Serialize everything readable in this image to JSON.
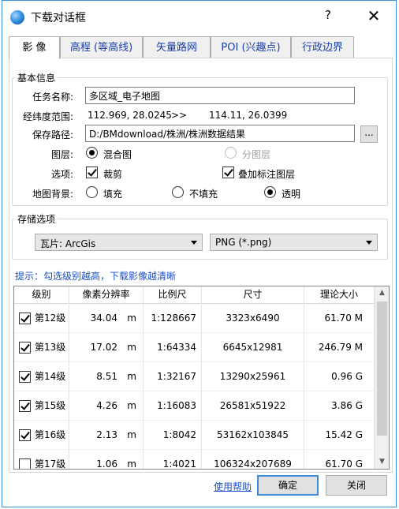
{
  "window": {
    "title": "下载对话框",
    "help_label": "?",
    "close_label": "✕"
  },
  "tabs": [
    {
      "label": "影 像",
      "active": true
    },
    {
      "label": "高程 (等高线)",
      "active": false
    },
    {
      "label": "矢量路网",
      "active": false
    },
    {
      "label": "POI (兴趣点)",
      "active": false
    },
    {
      "label": "行政边界",
      "active": false
    }
  ],
  "basic_info": {
    "group_title": "基本信息",
    "task_name_label": "任务名称:",
    "task_name_value": "多区域_电子地图",
    "lnglat_label": "经纬度范围:",
    "lnglat_from": "112.969, 28.0245",
    "lnglat_arrow": ">>",
    "lnglat_to": "114.11, 26.0399",
    "save_path_label": "保存路径:",
    "save_path_value": "D:/BMdownload/株洲/株洲数据结果",
    "browse_label": "...",
    "layer_label": "图层:",
    "layer_options": [
      {
        "label": "混合图",
        "selected": true,
        "disabled": false
      },
      {
        "label": "分图层",
        "selected": false,
        "disabled": true
      }
    ],
    "options_label": "选项:",
    "options": [
      {
        "label": "裁剪",
        "checked": true
      },
      {
        "label": "叠加标注图层",
        "checked": true
      }
    ],
    "background_label": "地图背景:",
    "background_options": [
      {
        "label": "填充",
        "selected": false
      },
      {
        "label": "不填充",
        "selected": false
      },
      {
        "label": "透明",
        "selected": true
      }
    ]
  },
  "storage": {
    "group_title": "存储选项",
    "tile_format": "瓦片: ArcGis",
    "image_format": "PNG (*.png)"
  },
  "hint": "提示：勾选级别越高，下载影像越清晰",
  "table": {
    "columns": [
      "级别",
      "像素分辨率",
      "比例尺",
      "尺寸",
      "理论大小"
    ],
    "rows": [
      {
        "checked": true,
        "level": "第12级",
        "resolution": "34.04",
        "unit": "m",
        "scale": "1:128667",
        "size": "3323x6490",
        "theory": "61.70 M"
      },
      {
        "checked": true,
        "level": "第13级",
        "resolution": "17.02",
        "unit": "m",
        "scale": "1:64334",
        "size": "6645x12981",
        "theory": "246.79 M"
      },
      {
        "checked": true,
        "level": "第14级",
        "resolution": "8.51",
        "unit": "m",
        "scale": "1:32167",
        "size": "13290x25961",
        "theory": "0.96 G"
      },
      {
        "checked": true,
        "level": "第15级",
        "resolution": "4.26",
        "unit": "m",
        "scale": "1:16083",
        "size": "26581x51922",
        "theory": "3.86 G"
      },
      {
        "checked": true,
        "level": "第16级",
        "resolution": "2.13",
        "unit": "m",
        "scale": "1:8042",
        "size": "53162x103845",
        "theory": "15.42 G"
      },
      {
        "checked": false,
        "level": "第17级",
        "resolution": "1.06",
        "unit": "m",
        "scale": "1:4021",
        "size": "106324x207689",
        "theory": "61.70 G"
      }
    ]
  },
  "footer": {
    "help_link": "使用帮助",
    "ok_label": "确定",
    "close_label": "关闭"
  }
}
